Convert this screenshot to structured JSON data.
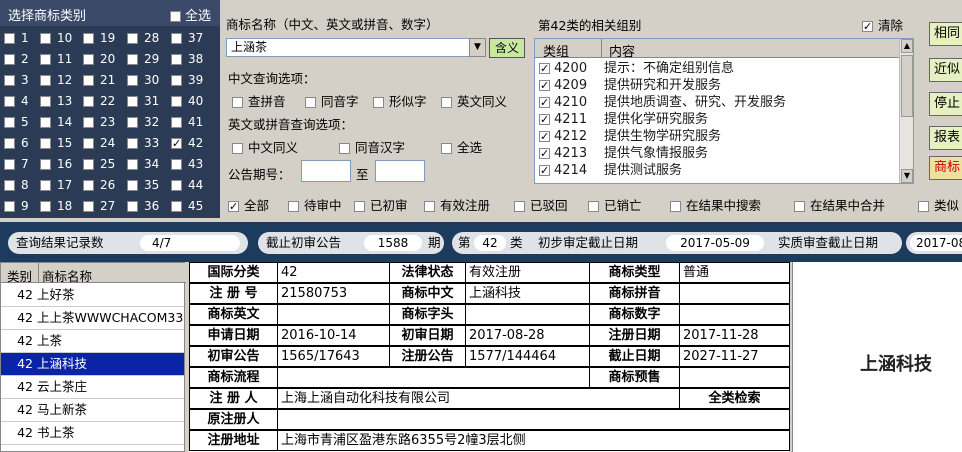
{
  "category_panel": {
    "title": "选择商标类别",
    "select_all": "全选",
    "columns": [
      [
        "1",
        "2",
        "3",
        "4",
        "5",
        "6",
        "7",
        "8",
        "9"
      ],
      [
        "10",
        "11",
        "12",
        "13",
        "14",
        "15",
        "16",
        "17",
        "18"
      ],
      [
        "19",
        "20",
        "21",
        "22",
        "23",
        "24",
        "25",
        "26",
        "27"
      ],
      [
        "28",
        "29",
        "30",
        "31",
        "32",
        "33",
        "34",
        "35",
        "36"
      ],
      [
        "37",
        "38",
        "39",
        "40",
        "41",
        "42",
        "43",
        "44",
        "45"
      ]
    ],
    "checked": [
      "42"
    ]
  },
  "search": {
    "name_label": "商标名称（中文、英文或拼音、数字）",
    "name_value": "上涵茶",
    "meaning_button": "含义",
    "cn_options_label": "中文查询选项：",
    "cn_options": [
      "查拼音",
      "同音字",
      "形似字",
      "英文同义"
    ],
    "en_options_label": "英文或拼音查询选项：",
    "en_options": [
      "中文同义",
      "同音汉字",
      "全选"
    ],
    "period_label": "公告期号：",
    "period_to": "至"
  },
  "groups": {
    "title": "第42类的相关组别",
    "clear_label": "清除",
    "col_group": "类组",
    "col_content": "内容",
    "rows": [
      {
        "code": "4200",
        "text": "提示：不确定组别信息"
      },
      {
        "code": "4209",
        "text": "提供研究和开发服务"
      },
      {
        "code": "4210",
        "text": "提供地质调查、研究、开发服务"
      },
      {
        "code": "4211",
        "text": "提供化学研究服务"
      },
      {
        "code": "4212",
        "text": "提供生物学研究服务"
      },
      {
        "code": "4213",
        "text": "提供气象情报服务"
      },
      {
        "code": "4214",
        "text": "提供测试服务"
      }
    ]
  },
  "right_buttons": [
    "相同",
    "近似",
    "停止",
    "报表",
    "商标"
  ],
  "filters": [
    "全部",
    "待审中",
    "已初审",
    "有效注册",
    "已驳回",
    "已销亡",
    "在结果中搜索",
    "在结果中合并",
    "类似"
  ],
  "status": {
    "count_label": "查询结果记录数",
    "count_value": "4/7",
    "cutoff_label": "截止初审公告",
    "cutoff_value": "1588",
    "cutoff_unit": "期",
    "class_prefix": "第",
    "class_value": "42",
    "class_suffix": "类",
    "prelim_label": "初步审定截止日期",
    "prelim_value": "2017-05-09",
    "exam_label": "实质审查截止日期",
    "exam_value": "2017-08"
  },
  "results": {
    "col_class": "类别",
    "col_name": "商标名称",
    "rows": [
      {
        "cls": "42",
        "name": "上好茶"
      },
      {
        "cls": "42",
        "name": "上上茶WWWCHACOM33"
      },
      {
        "cls": "42",
        "name": "上茶"
      },
      {
        "cls": "42",
        "name": "上涵科技"
      },
      {
        "cls": "42",
        "name": "云上茶庄"
      },
      {
        "cls": "42",
        "name": "马上新茶"
      },
      {
        "cls": "42",
        "name": "书上茶"
      }
    ],
    "selected_index": 3
  },
  "detail": {
    "intl_class_k": "国际分类",
    "intl_class_v": "42",
    "legal_k": "法律状态",
    "legal_v": "有效注册",
    "type_k": "商标类型",
    "type_v": "普通",
    "reg_no_k": "注 册 号",
    "reg_no_v": "21580753",
    "cn_k": "商标中文",
    "cn_v": "上涵科技",
    "pinyin_k": "商标拼音",
    "pinyin_v": "",
    "en_k": "商标英文",
    "en_v": "",
    "char_k": "商标字头",
    "char_v": "",
    "digit_k": "商标数字",
    "digit_v": "",
    "apply_k": "申请日期",
    "apply_v": "2016-10-14",
    "prelim_k": "初审日期",
    "prelim_v": "2017-08-28",
    "regdate_k": "注册日期",
    "regdate_v": "2017-11-28",
    "prelim_notice_k": "初审公告",
    "prelim_notice_v": "1565/17643",
    "reg_notice_k": "注册公告",
    "reg_notice_v": "1577/144464",
    "expire_k": "截止日期",
    "expire_v": "2027-11-27",
    "flow_k": "商标流程",
    "flow_v": "",
    "presale_k": "商标预售",
    "presale_v": "",
    "registrant_k": "注 册 人",
    "registrant_v": "上海上涵自动化科技有限公司",
    "all_class_search": "全类检索",
    "orig_registrant_k": "原注册人",
    "orig_registrant_v": "",
    "address_k": "注册地址",
    "address_v": "上海市青浦区盈港东路6355号2幢3层北侧"
  },
  "logo_text": "上涵科技"
}
